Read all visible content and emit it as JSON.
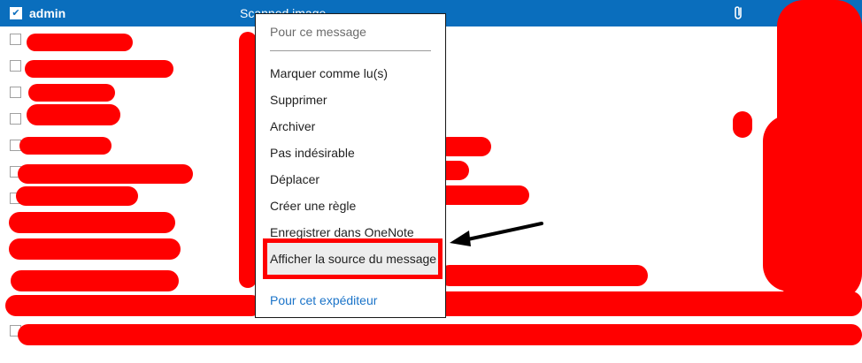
{
  "header": {
    "checkbox_glyph": "✔",
    "sender": "admin",
    "subject": "Scanned image",
    "attachment_icon": "paperclip-icon"
  },
  "context_menu": {
    "section_message": "Pour ce message",
    "items": [
      "Marquer comme lu(s)",
      "Supprimer",
      "Archiver",
      "Pas indésirable",
      "Déplacer",
      "Créer une règle",
      "Enregistrer dans OneNote",
      "Afficher la source du message"
    ],
    "section_sender": "Pour cet expéditeur"
  },
  "colors": {
    "header_bg": "#0a6ebd",
    "annotation": "#ff0000",
    "link": "#1a73c8"
  }
}
